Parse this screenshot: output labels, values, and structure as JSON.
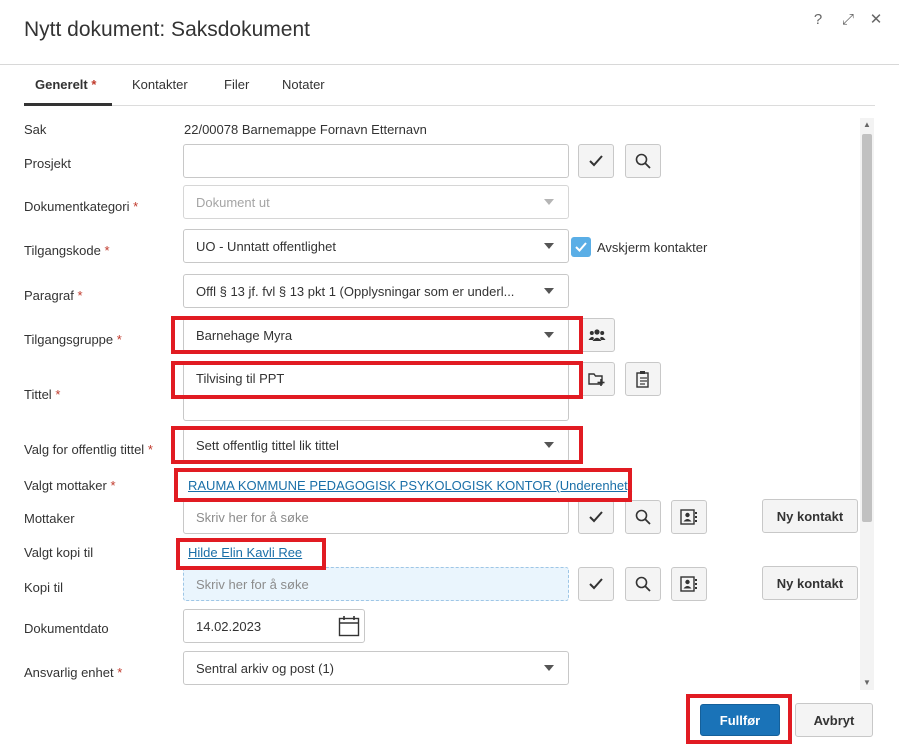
{
  "dialog": {
    "title": "Nytt dokument: Saksdokument",
    "help_glyph": "?",
    "expand_glyph": "⤢",
    "close_glyph": "✕"
  },
  "tabs": [
    {
      "label": "Generelt",
      "required_mark": "*",
      "active": true
    },
    {
      "label": "Kontakter",
      "active": false
    },
    {
      "label": "Filer",
      "active": false
    },
    {
      "label": "Notater",
      "active": false
    }
  ],
  "form": {
    "required_mark": "*",
    "sak": {
      "label": "Sak",
      "value": "22/00078 Barnemappe Fornavn Etternavn"
    },
    "prosjekt": {
      "label": "Prosjekt",
      "value": ""
    },
    "dokumentkategori": {
      "label": "Dokumentkategori",
      "value": "Dokument ut",
      "disabled": true
    },
    "tilgangskode": {
      "label": "Tilgangskode",
      "value": "UO - Unntatt offentlighet"
    },
    "avskjerm": {
      "label": "Avskjerm kontakter",
      "checked": true
    },
    "paragraf": {
      "label": "Paragraf",
      "value": "Offl § 13 jf. fvl § 13 pkt 1 (Opplysningar som er underl..."
    },
    "tilgangsgruppe": {
      "label": "Tilgangsgruppe",
      "value": "Barnehage Myra"
    },
    "tittel": {
      "label": "Tittel",
      "value": "Tilvising til PPT"
    },
    "offentlig_tittel": {
      "label": "Valg for offentlig tittel",
      "value": "Sett offentlig tittel lik tittel"
    },
    "valgt_mottaker": {
      "label": "Valgt mottaker",
      "value": "RAUMA KOMMUNE PEDAGOGISK PSYKOLOGISK KONTOR (Underenhet)"
    },
    "mottaker": {
      "label": "Mottaker",
      "placeholder": "Skriv her for å søke",
      "button": "Ny kontakt"
    },
    "valgt_kopi": {
      "label": "Valgt kopi til",
      "value": "Hilde Elin Kavli Ree"
    },
    "kopi": {
      "label": "Kopi til",
      "placeholder": "Skriv her for å søke",
      "button": "Ny kontakt"
    },
    "dokumentdato": {
      "label": "Dokumentdato",
      "value": "14.02.2023"
    },
    "ansvarlig_enhet": {
      "label": "Ansvarlig enhet",
      "value": "Sentral arkiv og post (1)"
    }
  },
  "footer": {
    "primary_label": "Fullfør",
    "secondary_label": "Avbryt"
  },
  "colors": {
    "primary": "#1a73b8",
    "required": "#c0392b",
    "highlight": "#e11b22",
    "link": "#1a6fa8"
  }
}
